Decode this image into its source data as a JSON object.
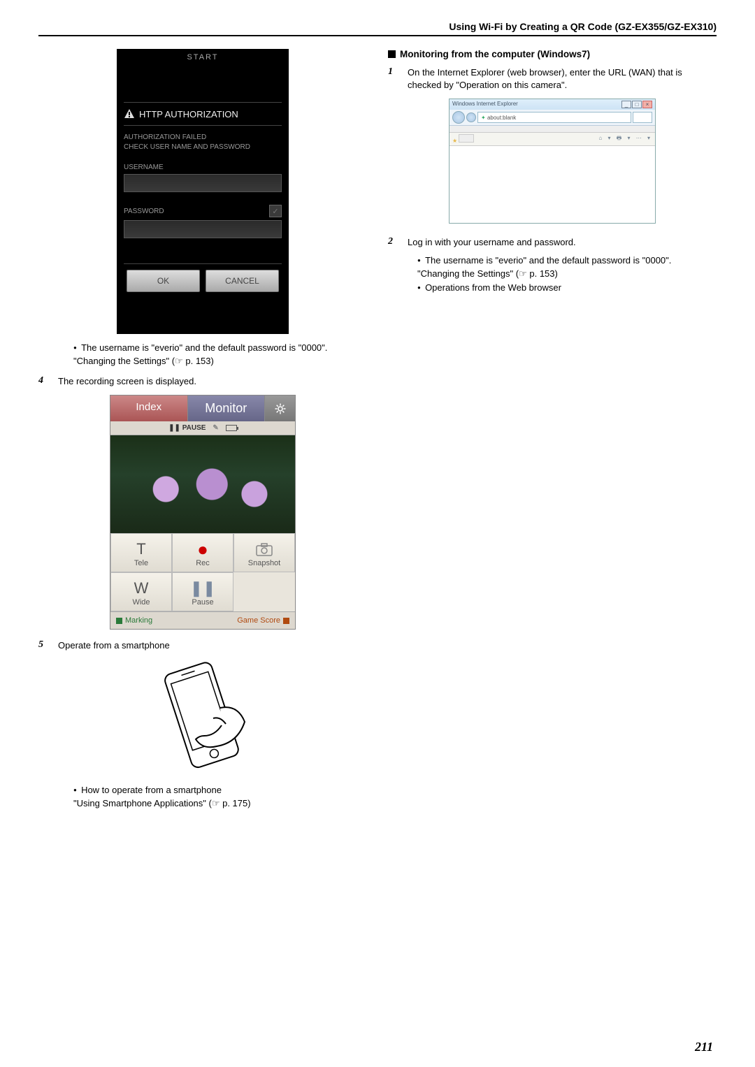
{
  "header": {
    "title": "Using Wi-Fi by Creating a QR Code (GZ-EX355/GZ-EX310)"
  },
  "auth_screen": {
    "start": "START",
    "heading": "HTTP AUTHORIZATION",
    "fail_1": "AUTHORIZATION FAILED",
    "fail_2": "CHECK USER NAME AND PASSWORD",
    "user_label": "USERNAME",
    "pass_label": "PASSWORD",
    "ok": "OK",
    "cancel": "CANCEL"
  },
  "left_note_bullet": "The username is \"everio\" and the default password is \"0000\".",
  "left_note_link": "\"Changing the Settings\" (☞ p. 153)",
  "step4": {
    "num": "4",
    "text": "The recording screen is displayed."
  },
  "monitor_app": {
    "tab_index": "Index",
    "tab_monitor": "Monitor",
    "pause": "❚❚ PAUSE",
    "ctrls": {
      "tele": "Tele",
      "rec": "Rec",
      "snapshot": "Snapshot",
      "wide": "Wide",
      "pause": "Pause"
    },
    "marking": "Marking",
    "gamescore": "Game Score"
  },
  "step5": {
    "num": "5",
    "text": "Operate from a smartphone"
  },
  "left_note2_bullet": "How to operate from a smartphone",
  "left_note2_link": "\"Using Smartphone Applications\" (☞ p. 175)",
  "right": {
    "subheading": "Monitoring from the computer (Windows7)",
    "step1": {
      "num": "1",
      "text": "On the Internet Explorer (web browser), enter the URL (WAN) that is checked by \"Operation on this camera\"."
    },
    "ie": {
      "title": "Windows Internet Explorer",
      "addr": "about:blank"
    },
    "step2": {
      "num": "2",
      "text": "Log in with your username and password.",
      "b1": "The username is \"everio\" and the default password is \"0000\".",
      "link": "\"Changing the Settings\" (☞ p. 153)",
      "b2": "Operations from the Web browser"
    }
  },
  "page_num": "211"
}
